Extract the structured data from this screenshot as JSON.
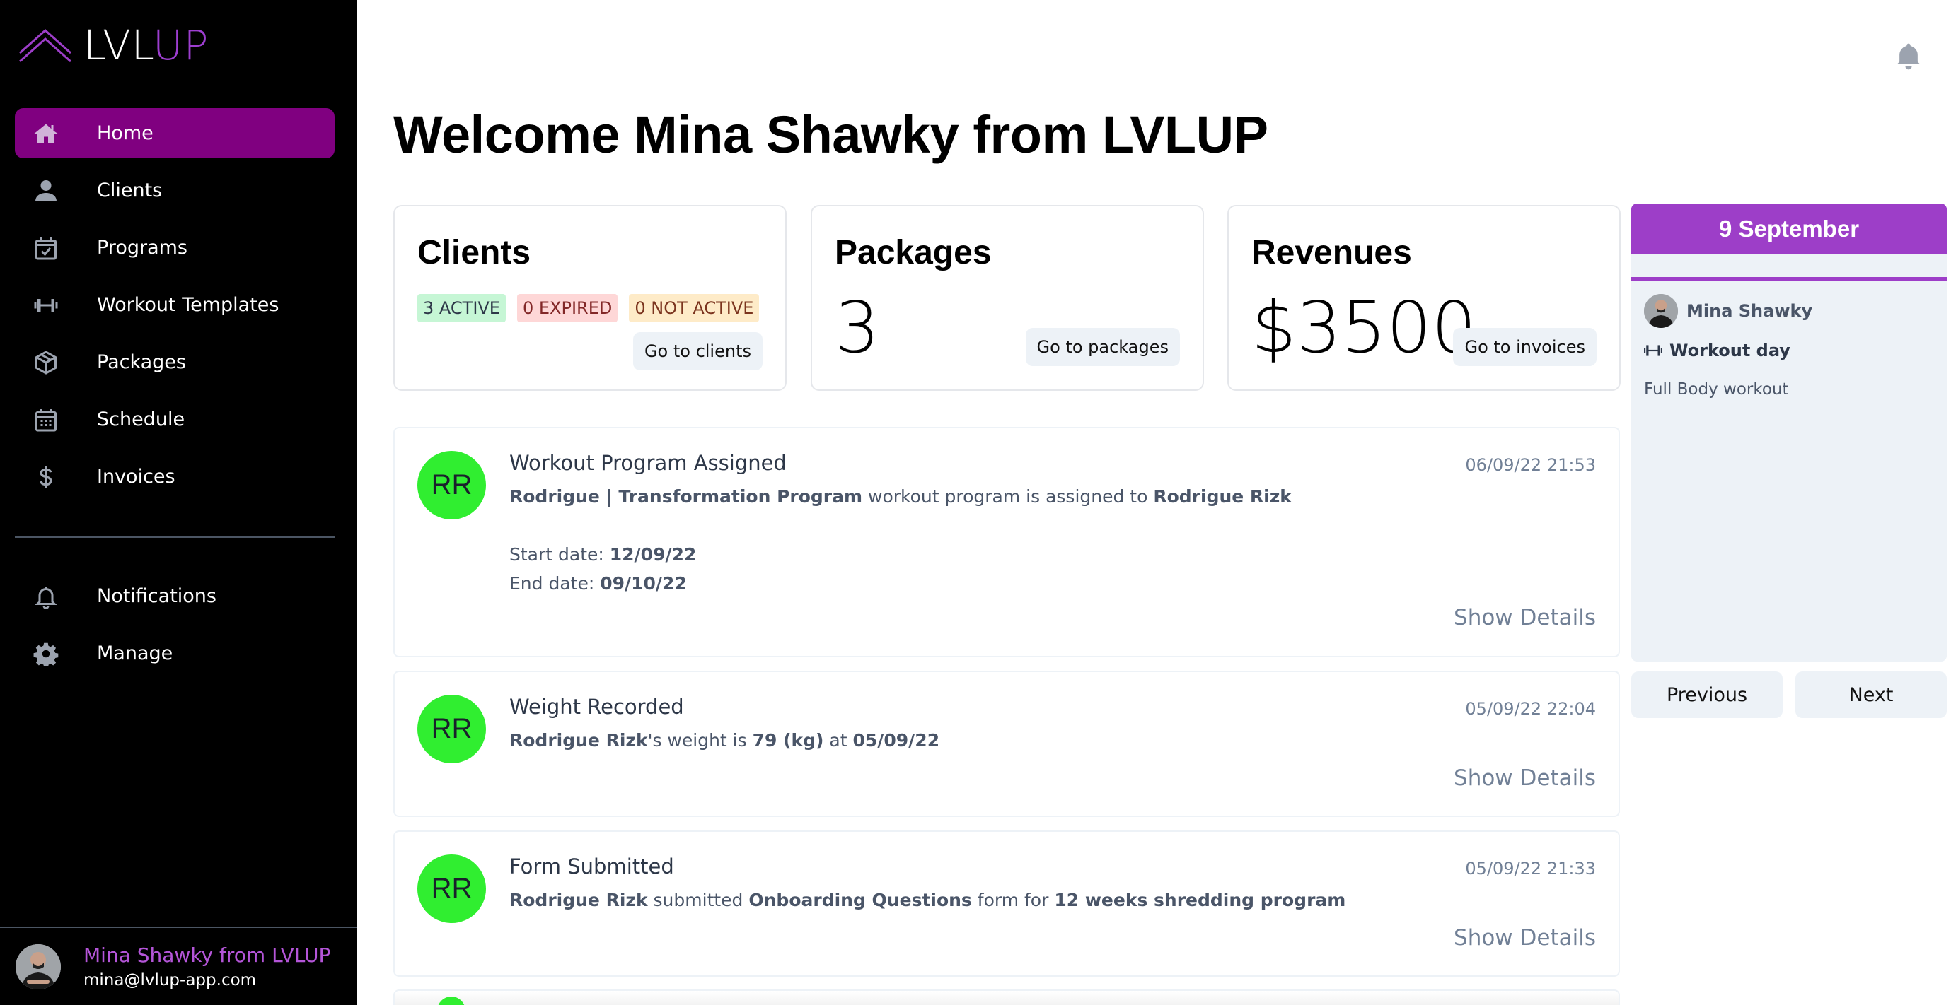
{
  "app": {
    "logo_text_primary": "LVL",
    "logo_text_accent": "UP",
    "accent_color": "#9d3ec8",
    "active_nav_color": "#800080"
  },
  "sidebar": {
    "items": [
      {
        "label": "Home",
        "icon": "home-icon",
        "active": true
      },
      {
        "label": "Clients",
        "icon": "user-icon"
      },
      {
        "label": "Programs",
        "icon": "calendar-check-icon"
      },
      {
        "label": "Workout Templates",
        "icon": "dumbbell-icon"
      },
      {
        "label": "Packages",
        "icon": "box-icon"
      },
      {
        "label": "Schedule",
        "icon": "calendar-icon"
      },
      {
        "label": "Invoices",
        "icon": "dollar-icon"
      }
    ],
    "secondary_items": [
      {
        "label": "Notifications",
        "icon": "bell-icon"
      },
      {
        "label": "Manage",
        "icon": "gear-icon"
      }
    ],
    "user": {
      "name": "Mina Shawky from LVLUP",
      "email": "mina@lvlup-app.com"
    }
  },
  "header": {
    "title": "Welcome Mina Shawky from LVLUP"
  },
  "stats": {
    "clients": {
      "title": "Clients",
      "badges": {
        "active": "3 ACTIVE",
        "expired": "0 EXPIRED",
        "not_active": "0 NOT ACTIVE"
      },
      "button": "Go to clients"
    },
    "packages": {
      "title": "Packages",
      "value": "3",
      "button": "Go to packages"
    },
    "revenues": {
      "title": "Revenues",
      "value": "$3500",
      "button": "Go to invoices"
    }
  },
  "calendar": {
    "date": "9 September",
    "user": "Mina Shawky",
    "event_title": "Workout day",
    "event_desc": "Full Body workout",
    "prev_label": "Previous",
    "next_label": "Next"
  },
  "feed": [
    {
      "initials": "RR",
      "title": "Workout Program Assigned",
      "time": "06/09/22 21:53",
      "text_parts": {
        "b1": "Rodrigue | Transformation Program",
        "t1": " workout program is assigned to ",
        "b2": "Rodrigue Rizk"
      },
      "start_label": "Start date: ",
      "start_value": "12/09/22",
      "end_label": "End date: ",
      "end_value": "09/10/22",
      "action": "Show Details"
    },
    {
      "initials": "RR",
      "title": "Weight Recorded",
      "time": "05/09/22 22:04",
      "text_parts": {
        "b1": "Rodrigue Rizk",
        "t1": "'s weight is ",
        "b2": "79 (kg)",
        "t2": " at ",
        "b3": "05/09/22"
      },
      "action": "Show Details"
    },
    {
      "initials": "RR",
      "title": "Form Submitted",
      "time": "05/09/22 21:33",
      "text_parts": {
        "b1": "Rodrigue Rizk",
        "t1": " submitted ",
        "b2": "Onboarding Questions",
        "t2": " form for ",
        "b3": "12 weeks shredding program"
      },
      "action": "Show Details"
    }
  ]
}
